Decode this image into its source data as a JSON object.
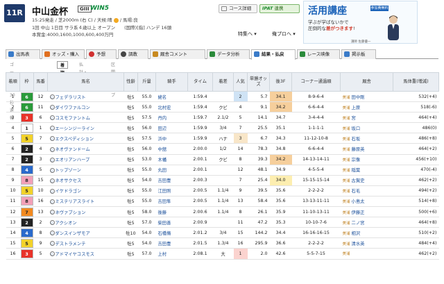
{
  "race": {
    "number": "11R",
    "name": "中山金杯",
    "grade": "GIII",
    "win5": "WIN5",
    "line1_pre": "15:25発走 / 芝2000m (右 C) / 天候:晴",
    "line1_post": "/ 馬場:良",
    "line2": "1回 中山 1日目 サラ系４歳以上 オープン　　(国際)[指] ハンデ 16頭",
    "line3": "本賞金:4000,1600,1000,600,400万円"
  },
  "header_buttons": {
    "course": "コース詳細",
    "ipat_brand": "IPAT",
    "ipat_label": "連携",
    "tokusyu": "特集ヘ",
    "ore": "俺プロへ"
  },
  "ad": {
    "title": "活用講座",
    "tag": "参加費無料",
    "line1": "学ぶが学ばないかで",
    "line2_pre": "圧倒的な",
    "line2_em": "差がつきます",
    "line2_post": "!",
    "caption": "講師 佐藤優一"
  },
  "tabs": [
    {
      "label": "出馬表",
      "color": "#3a7bc8"
    },
    {
      "label": "オッズ・購入",
      "color": "#e07020"
    },
    {
      "label": "予想",
      "color": "#d03030"
    },
    {
      "label": "調教",
      "color": "#444444"
    },
    {
      "label": "厩舎コメント",
      "color": "#c88a20"
    },
    {
      "label": "データ分析",
      "color": "#2a8a3a"
    },
    {
      "label": "結果・払戻",
      "color": "#3a7bc8"
    },
    {
      "label": "レース映像",
      "color": "#2a8a3a"
    },
    {
      "label": "掲示板",
      "color": "#3a7bc8"
    }
  ],
  "subtabs": [
    "ゴール後 30秒速報",
    "着順",
    "払計・回顧",
    "区間ラップ"
  ],
  "columns": [
    "着順",
    "枠",
    "馬番",
    "馬名",
    "性齢",
    "斤量",
    "騎手",
    "タイム",
    "着差",
    "人気",
    "単勝オッズ",
    "後3F",
    "コーナー通過順",
    "厩舎",
    "馬体重(増減)"
  ],
  "rows": [
    {
      "rank": "1",
      "waku": "6",
      "num": "12",
      "name": "フェデラリスト",
      "sex": "牡5",
      "wt": "55.0",
      "jockey": "蛯名",
      "time": "1:59.4",
      "diff": "",
      "pop": "2",
      "odds": "5.7",
      "l3f": "34.1",
      "corner": "8-9-6-4",
      "area": "美浦",
      "trainer": "田中剛",
      "hw": "532(+4)"
    },
    {
      "rank": "2",
      "waku": "6",
      "num": "11",
      "name": "ダイワファルコン",
      "sex": "牡5",
      "wt": "55.0",
      "jockey": "北村宏",
      "time": "1:59.4",
      "diff": "クビ",
      "pop": "4",
      "odds": "9.1",
      "l3f": "34.2",
      "corner": "6-6-4-4",
      "area": "美浦",
      "trainer": "上原",
      "hw": "518(-6)"
    },
    {
      "rank": "3",
      "waku": "3",
      "num": "6",
      "name": "コスモファントム",
      "sex": "牡5",
      "wt": "57.5",
      "jockey": "丹内",
      "time": "1:59.7",
      "diff": "2.1/2",
      "pop": "5",
      "odds": "14.1",
      "l3f": "34.7",
      "corner": "3-4-4-4",
      "area": "美浦",
      "trainer": "宮",
      "hw": "464(+4)"
    },
    {
      "rank": "4",
      "waku": "1",
      "num": "1",
      "name": "エーシンジーライン",
      "sex": "牡5",
      "wt": "56.0",
      "jockey": "田辺",
      "time": "1:59.9",
      "diff": "3/4",
      "pop": "7",
      "odds": "25.5",
      "l3f": "35.1",
      "corner": "1-1-1-1",
      "area": "美浦",
      "trainer": "坂口",
      "hw": "486(0)"
    },
    {
      "rank": "5",
      "waku": "5",
      "num": "7",
      "name": "エクスペディション",
      "sex": "牡5",
      "wt": "57.5",
      "jockey": "浜中",
      "time": "1:59.9",
      "diff": "ハナ",
      "pop": "3",
      "odds": "6.7",
      "l3f": "34.3",
      "corner": "11-12-10-8",
      "area": "美浦",
      "trainer": "石坂",
      "hw": "486(+8)"
    },
    {
      "rank": "6",
      "waku": "2",
      "num": "4",
      "name": "ネオヴァンドーム",
      "sex": "牡5",
      "wt": "56.0",
      "jockey": "中舘",
      "time": "2:00.0",
      "diff": "1/2",
      "pop": "14",
      "odds": "78.3",
      "l3f": "34.8",
      "corner": "6-6-4-4",
      "area": "美浦",
      "trainer": "藤原英",
      "hw": "464(+2)"
    },
    {
      "rank": "7",
      "waku": "2",
      "num": "3",
      "name": "エオリアンハープ",
      "sex": "牡5",
      "wt": "53.0",
      "jockey": "木幡",
      "time": "2:00.1",
      "diff": "クビ",
      "pop": "8",
      "odds": "39.3",
      "l3f": "34.2",
      "corner": "14-13-14-11",
      "area": "美浦",
      "trainer": "宗像",
      "hw": "456(+10)"
    },
    {
      "rank": "8",
      "waku": "4",
      "num": "5",
      "name": "トップゾーン",
      "sex": "牡5",
      "wt": "55.0",
      "jockey": "丸田",
      "time": "2:00.1",
      "diff": "",
      "pop": "12",
      "odds": "48.1",
      "l3f": "34.9",
      "corner": "4-5-5-4",
      "area": "美浦",
      "trainer": "稲葉",
      "hw": "470(-4)"
    },
    {
      "rank": "9",
      "waku": "8",
      "num": "15",
      "name": "ネオサクセス",
      "sex": "牡5",
      "wt": "54.0",
      "jockey": "吉田豊",
      "time": "2:00.3",
      "diff": "",
      "pop": "7",
      "odds": "25.4",
      "l3f": "34.0",
      "corner": "15-15-15-14",
      "area": "美浦",
      "trainer": "古賀史",
      "hw": "462(+2)"
    },
    {
      "rank": "10",
      "waku": "5",
      "num": "10",
      "name": "イケドラゴン",
      "sex": "牡5",
      "wt": "55.0",
      "jockey": "江田照",
      "time": "2:00.5",
      "diff": "1.1/4",
      "pop": "9",
      "odds": "39.5",
      "l3f": "35.6",
      "corner": "2-2-2-2",
      "area": "美浦",
      "trainer": "石毛",
      "hw": "494(+2)"
    },
    {
      "rank": "11",
      "waku": "8",
      "num": "16",
      "name": "ミステリアスライト",
      "sex": "牡5",
      "wt": "55.0",
      "jockey": "吉田隼",
      "time": "2:00.5",
      "diff": "1.1/4",
      "pop": "13",
      "odds": "58.4",
      "l3f": "35.6",
      "corner": "13-13-11-11",
      "area": "美浦",
      "trainer": "小島太",
      "hw": "514(+8)"
    },
    {
      "rank": "12",
      "waku": "7",
      "num": "13",
      "name": "ネヴァブション",
      "sex": "牡5",
      "wt": "58.0",
      "jockey": "後藤",
      "time": "2:00.6",
      "diff": "1.1/4",
      "pop": "8",
      "odds": "26.1",
      "l3f": "35.9",
      "corner": "11-10-13-11",
      "area": "美浦",
      "trainer": "伊藤正",
      "hw": "500(+6)"
    },
    {
      "rank": "13",
      "waku": "2",
      "num": "2",
      "name": "アクシオン",
      "sex": "牡5",
      "wt": "57.0",
      "jockey": "柴田善",
      "time": "2:00.9",
      "diff": "",
      "pop": "11",
      "odds": "47.2",
      "l3f": "35.3",
      "corner": "10-10-7-6",
      "area": "美浦",
      "trainer": "二ノ宮",
      "hw": "464(+8)"
    },
    {
      "rank": "14",
      "waku": "4",
      "num": "8",
      "name": "ダンスインザモア",
      "sex": "牡10",
      "wt": "54.0",
      "jockey": "石橋脩",
      "time": "2:01.2",
      "diff": "3/4",
      "pop": "15",
      "odds": "144.2",
      "l3f": "34.4",
      "corner": "16-16-16-15",
      "area": "美浦",
      "trainer": "相沢",
      "hw": "510(+2)"
    },
    {
      "rank": "15",
      "waku": "5",
      "num": "9",
      "name": "デストラメンテ",
      "sex": "牡5",
      "wt": "54.0",
      "jockey": "吉田豊",
      "time": "2:01.5",
      "diff": "1.3/4",
      "pop": "16",
      "odds": "295.9",
      "l3f": "36.6",
      "corner": "2-2-2-2",
      "area": "美浦",
      "trainer": "清水英",
      "hw": "484(+4)"
    },
    {
      "rank": "16",
      "waku": "3",
      "num": "5",
      "name": "アドマイヤコスモス",
      "sex": "牡5",
      "wt": "57.0",
      "jockey": "上村",
      "time": "2:08.1",
      "diff": "大",
      "pop": "1",
      "odds": "2.0",
      "l3f": "42.6",
      "corner": "5-5-7-15",
      "area": "美浦",
      "trainer": "",
      "hw": "462(+2)"
    }
  ],
  "colors": {
    "header_bg": "#eaeef3",
    "pop1": "#fbd3cf",
    "pop2": "#cfe3f5",
    "pop3": "#f8e6c8",
    "last3f_best": "#fdeeb0",
    "last3f_2nd": "#f6cf9c"
  }
}
